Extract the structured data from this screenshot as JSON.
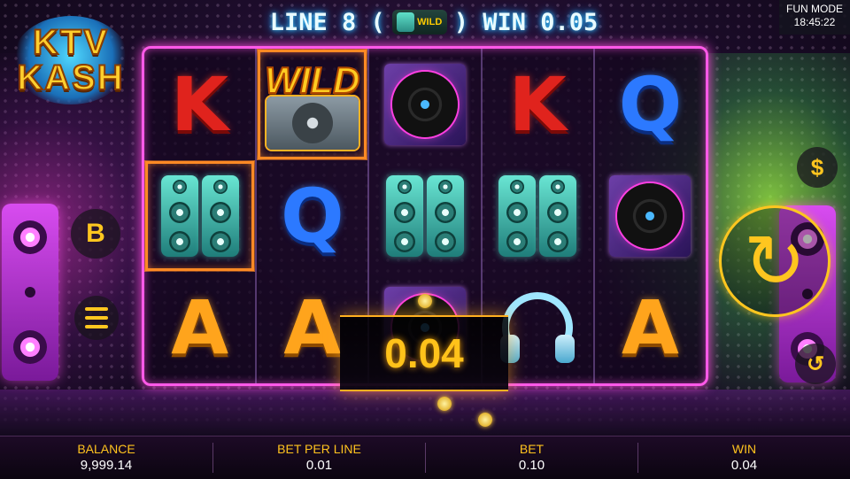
{
  "header": {
    "line_prefix": "LINE 8 (",
    "line_symbol_icon": "speaker-wild-icon",
    "line_symbol_label": "WILD",
    "line_suffix": ") WIN 0.05",
    "mode": "FUN MODE",
    "time": "18:45:22"
  },
  "logo": {
    "line1": "KTV",
    "line2": "KASH"
  },
  "reels": [
    [
      {
        "symbol": "K"
      },
      {
        "symbol": "speaker",
        "win": true
      },
      {
        "symbol": "A"
      }
    ],
    [
      {
        "symbol": "wild",
        "label": "WILD"
      },
      {
        "symbol": "Q"
      },
      {
        "symbol": "A"
      }
    ],
    [
      {
        "symbol": "vinyl"
      },
      {
        "symbol": "speaker"
      },
      {
        "symbol": "vinyl"
      }
    ],
    [
      {
        "symbol": "K"
      },
      {
        "symbol": "speaker"
      },
      {
        "symbol": "headphones"
      }
    ],
    [
      {
        "symbol": "Q"
      },
      {
        "symbol": "vinyl"
      },
      {
        "symbol": "A"
      }
    ]
  ],
  "symbols": {
    "K": "K",
    "Q": "Q",
    "A": "A"
  },
  "win_popup": "0.04",
  "controls": {
    "bet_button": "B",
    "dollar_button": "$",
    "menu_icon": "hamburger-icon",
    "spin_icon": "spin-arrows-icon",
    "autoplay_icon": "autoplay-icon"
  },
  "bottom_bar": {
    "balance_label": "BALANCE",
    "balance_value": "9,999.14",
    "bet_per_line_label": "BET PER LINE",
    "bet_per_line_value": "0.01",
    "bet_label": "BET",
    "bet_value": "0.10",
    "win_label": "WIN",
    "win_value": "0.04"
  },
  "colors": {
    "accent_gold": "#ffc61f",
    "frame_pink": "#ff59e8",
    "text_glow_blue": "#35c8ff"
  }
}
